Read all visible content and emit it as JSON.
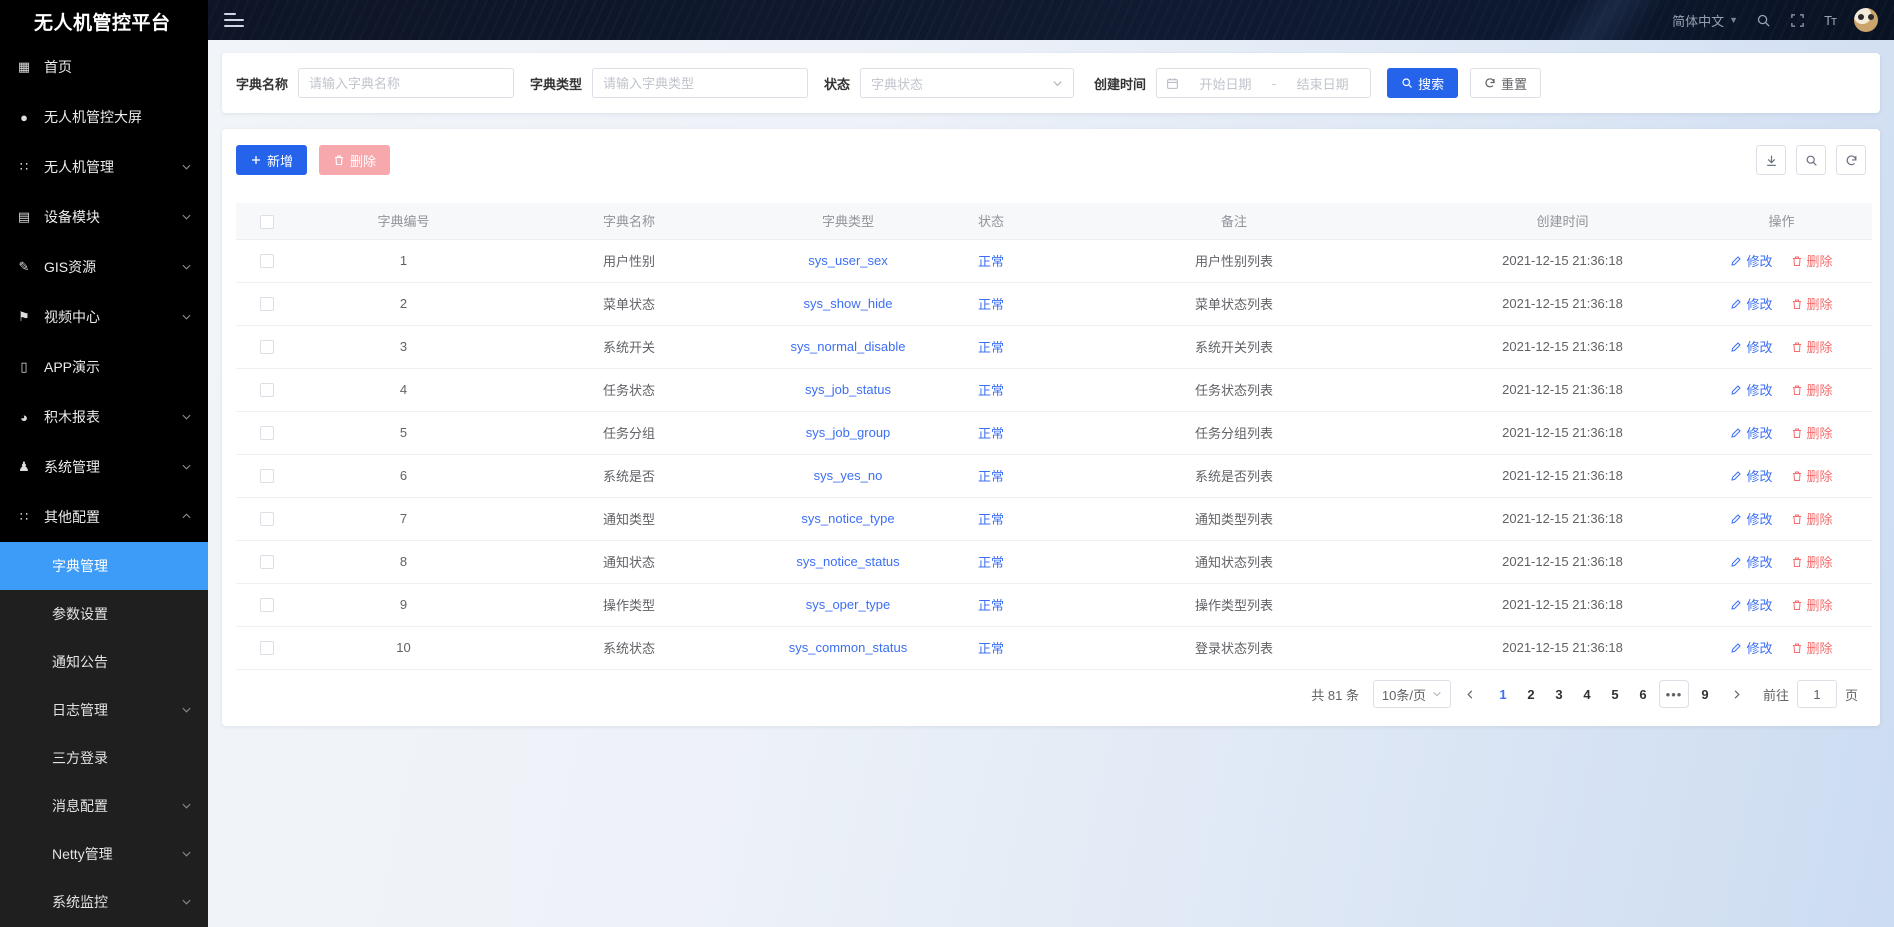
{
  "colors": {
    "accent": "#2563eb",
    "link": "#3b6ff5",
    "menu_active": "#3d9cf7",
    "danger": "#f56c6c",
    "danger_disabled": "#f6a8ad"
  },
  "app": {
    "title": "无人机管控平台"
  },
  "navbar": {
    "language": "简体中文"
  },
  "sidebar": {
    "items": [
      {
        "label": "首页",
        "icon": "home-icon",
        "glyph": "▦",
        "arrow": "none"
      },
      {
        "label": "无人机管控大屏",
        "icon": "screen-icon",
        "glyph": "●",
        "arrow": "none"
      },
      {
        "label": "无人机管理",
        "icon": "drone-icon",
        "glyph": "∷",
        "arrow": "down"
      },
      {
        "label": "设备模块",
        "icon": "device-icon",
        "glyph": "▤",
        "arrow": "down"
      },
      {
        "label": "GIS资源",
        "icon": "gis-icon",
        "glyph": "✎",
        "arrow": "down"
      },
      {
        "label": "视频中心",
        "icon": "video-icon",
        "glyph": "⚑",
        "arrow": "down"
      },
      {
        "label": "APP演示",
        "icon": "app-icon",
        "glyph": "▯",
        "arrow": "none"
      },
      {
        "label": "积木报表",
        "icon": "report-icon",
        "glyph": "◕",
        "arrow": "down"
      },
      {
        "label": "系统管理",
        "icon": "system-icon",
        "glyph": "♟",
        "arrow": "down"
      },
      {
        "label": "其他配置",
        "icon": "config-icon",
        "glyph": "∷",
        "arrow": "up"
      }
    ],
    "submenu": [
      {
        "label": "字典管理",
        "active": true,
        "arrow": "none"
      },
      {
        "label": "参数设置",
        "active": false,
        "arrow": "none"
      },
      {
        "label": "通知公告",
        "active": false,
        "arrow": "none"
      },
      {
        "label": "日志管理",
        "active": false,
        "arrow": "down"
      },
      {
        "label": "三方登录",
        "active": false,
        "arrow": "none"
      },
      {
        "label": "消息配置",
        "active": false,
        "arrow": "down"
      },
      {
        "label": "Netty管理",
        "active": false,
        "arrow": "down"
      },
      {
        "label": "系统监控",
        "active": false,
        "arrow": "down"
      }
    ]
  },
  "filters": {
    "name_label": "字典名称",
    "name_placeholder": "请输入字典名称",
    "type_label": "字典类型",
    "type_placeholder": "请输入字典类型",
    "status_label": "状态",
    "status_placeholder": "字典状态",
    "created_label": "创建时间",
    "date_start_placeholder": "开始日期",
    "date_separator": "-",
    "date_end_placeholder": "结束日期",
    "search_label": "搜索",
    "reset_label": "重置"
  },
  "toolbar": {
    "add_label": "新增",
    "delete_label": "删除"
  },
  "table": {
    "columns": [
      "字典编号",
      "字典名称",
      "字典类型",
      "状态",
      "备注",
      "创建时间",
      "操作"
    ],
    "edit_label": "修改",
    "delete_label": "删除",
    "rows": [
      {
        "id": "1",
        "name": "用户性别",
        "type": "sys_user_sex",
        "status": "正常",
        "remark": "用户性别列表",
        "created": "2021-12-15 21:36:18"
      },
      {
        "id": "2",
        "name": "菜单状态",
        "type": "sys_show_hide",
        "status": "正常",
        "remark": "菜单状态列表",
        "created": "2021-12-15 21:36:18"
      },
      {
        "id": "3",
        "name": "系统开关",
        "type": "sys_normal_disable",
        "status": "正常",
        "remark": "系统开关列表",
        "created": "2021-12-15 21:36:18"
      },
      {
        "id": "4",
        "name": "任务状态",
        "type": "sys_job_status",
        "status": "正常",
        "remark": "任务状态列表",
        "created": "2021-12-15 21:36:18"
      },
      {
        "id": "5",
        "name": "任务分组",
        "type": "sys_job_group",
        "status": "正常",
        "remark": "任务分组列表",
        "created": "2021-12-15 21:36:18"
      },
      {
        "id": "6",
        "name": "系统是否",
        "type": "sys_yes_no",
        "status": "正常",
        "remark": "系统是否列表",
        "created": "2021-12-15 21:36:18"
      },
      {
        "id": "7",
        "name": "通知类型",
        "type": "sys_notice_type",
        "status": "正常",
        "remark": "通知类型列表",
        "created": "2021-12-15 21:36:18"
      },
      {
        "id": "8",
        "name": "通知状态",
        "type": "sys_notice_status",
        "status": "正常",
        "remark": "通知状态列表",
        "created": "2021-12-15 21:36:18"
      },
      {
        "id": "9",
        "name": "操作类型",
        "type": "sys_oper_type",
        "status": "正常",
        "remark": "操作类型列表",
        "created": "2021-12-15 21:36:18"
      },
      {
        "id": "10",
        "name": "系统状态",
        "type": "sys_common_status",
        "status": "正常",
        "remark": "登录状态列表",
        "created": "2021-12-15 21:36:18"
      }
    ]
  },
  "pagination": {
    "total": "共 81 条",
    "page_size": "10条/页",
    "pages": [
      "1",
      "2",
      "3",
      "4",
      "5",
      "6"
    ],
    "ellipsis": "•••",
    "last_page": "9",
    "active_page": "1",
    "goto_label": "前往",
    "goto_value": "1",
    "goto_unit": "页"
  }
}
